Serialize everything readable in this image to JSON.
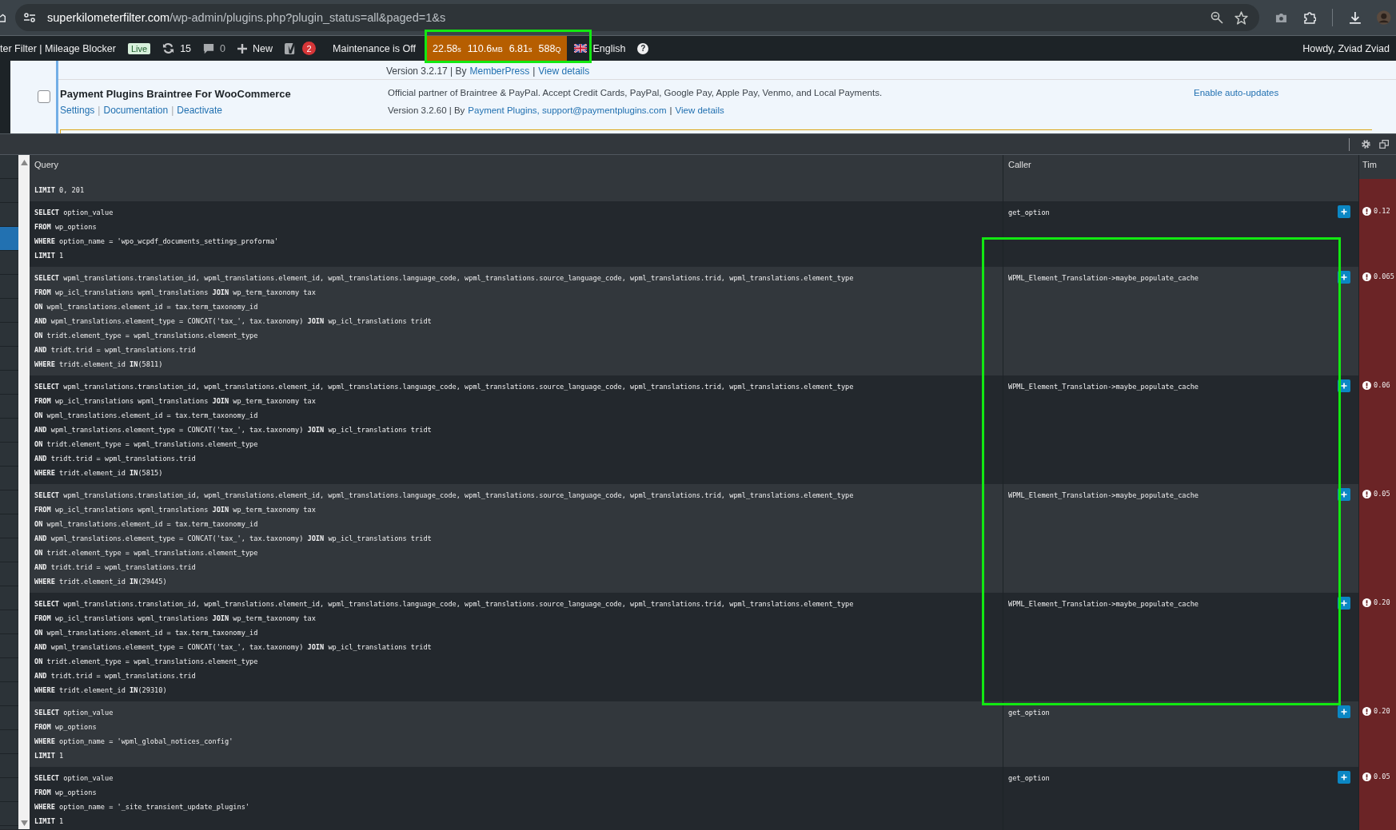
{
  "browser": {
    "url_domain": "superkilometerfilter.com",
    "url_path": "/wp-admin/plugins.php?plugin_status=all&paged=1&s"
  },
  "admin_bar": {
    "site_title": "ter Filter | Mileage Blocker",
    "site_badge": "Live",
    "updates": "15",
    "comments": "0",
    "new": "New",
    "yoast_count": "2",
    "maintenance": "Maintenance is Off",
    "qm_stats": [
      {
        "value": "22.58",
        "unit": "s"
      },
      {
        "value": "110.6",
        "unit": "MB"
      },
      {
        "value": "6.81",
        "unit": "s"
      },
      {
        "value": "588",
        "unit": "Q"
      }
    ],
    "language": "English",
    "help": "?",
    "greeting": "Howdy, Zviad Zviad"
  },
  "plugins": {
    "previous_row": [
      {
        "kind": "text",
        "text": "Version 3.2.17 | By"
      },
      {
        "kind": "link",
        "text": "MemberPress"
      },
      {
        "kind": "text",
        "text": "|"
      },
      {
        "kind": "link",
        "text": "View details"
      }
    ],
    "row": {
      "checked": false,
      "name": "Payment Plugins Braintree For WooCommerce",
      "separator": "|",
      "actions": [
        "Settings",
        "Documentation",
        "Deactivate"
      ],
      "description": "Official partner of Braintree & PayPal. Accept Credit Cards, PayPal, Google Pay, Apple Pay, Venmo, and Local Payments.",
      "meta": [
        {
          "kind": "text",
          "text": "Version 3.2.60 | By"
        },
        {
          "kind": "link",
          "text": "Payment Plugins, support@paymentplugins.com"
        },
        {
          "kind": "text",
          "text": "|"
        },
        {
          "kind": "link",
          "text": "View details"
        }
      ],
      "auto_update": "Enable auto-updates"
    }
  },
  "sidebar_items": [
    {
      "selected": false
    },
    {
      "selected": false
    },
    {
      "selected": false
    },
    {
      "selected": true
    },
    {
      "selected": false
    },
    {
      "selected": false
    },
    {
      "selected": false
    },
    {
      "selected": false
    },
    {
      "selected": false
    },
    {
      "selected": false
    },
    {
      "selected": false
    },
    {
      "selected": false
    },
    {
      "selected": false
    },
    {
      "selected": false
    },
    {
      "selected": false
    },
    {
      "selected": false
    },
    {
      "selected": false
    },
    {
      "selected": false
    },
    {
      "selected": false
    },
    {
      "selected": false
    },
    {
      "selected": false
    },
    {
      "selected": false
    },
    {
      "selected": false
    },
    {
      "selected": false
    },
    {
      "selected": false
    },
    {
      "selected": false
    },
    {
      "selected": false
    },
    {
      "selected": false
    }
  ],
  "query_monitor": {
    "columns": [
      "Query",
      "Caller",
      "Tim"
    ],
    "rows": [
      {
        "lines": [
          "**LIMIT** 0, 201"
        ]
      },
      {
        "lines": [
          "**SELECT** option_value",
          "**FROM** wp_options",
          "**WHERE** option_name = 'wpo_wcpdf_documents_settings_proforma'",
          "**LIMIT** 1"
        ],
        "caller": "get_option",
        "time": "0.12"
      },
      {
        "lines": [
          "**SELECT** wpml_translations.translation_id, wpml_translations.element_id, wpml_translations.language_code, wpml_translations.source_language_code, wpml_translations.trid, wpml_translations.element_type",
          "**FROM** wp_icl_translations wpml_translations **JOIN** wp_term_taxonomy tax",
          "**ON** wpml_translations.element_id = tax.term_taxonomy_id",
          "**AND** wpml_translations.element_type = CONCAT('tax_', tax.taxonomy) **JOIN** wp_icl_translations tridt",
          "**ON** tridt.element_type = wpml_translations.element_type",
          "**AND** tridt.trid = wpml_translations.trid",
          "**WHERE** tridt.element_id **IN**(5811)"
        ],
        "caller": "WPML_Element_Translation->maybe_populate_cache",
        "time": "0.065"
      },
      {
        "lines": [
          "**SELECT** wpml_translations.translation_id, wpml_translations.element_id, wpml_translations.language_code, wpml_translations.source_language_code, wpml_translations.trid, wpml_translations.element_type",
          "**FROM** wp_icl_translations wpml_translations **JOIN** wp_term_taxonomy tax",
          "**ON** wpml_translations.element_id = tax.term_taxonomy_id",
          "**AND** wpml_translations.element_type = CONCAT('tax_', tax.taxonomy) **JOIN** wp_icl_translations tridt",
          "**ON** tridt.element_type = wpml_translations.element_type",
          "**AND** tridt.trid = wpml_translations.trid",
          "**WHERE** tridt.element_id **IN**(5815)"
        ],
        "caller": "WPML_Element_Translation->maybe_populate_cache",
        "time": "0.06"
      },
      {
        "lines": [
          "**SELECT** wpml_translations.translation_id, wpml_translations.element_id, wpml_translations.language_code, wpml_translations.source_language_code, wpml_translations.trid, wpml_translations.element_type",
          "**FROM** wp_icl_translations wpml_translations **JOIN** wp_term_taxonomy tax",
          "**ON** wpml_translations.element_id = tax.term_taxonomy_id",
          "**AND** wpml_translations.element_type = CONCAT('tax_', tax.taxonomy) **JOIN** wp_icl_translations tridt",
          "**ON** tridt.element_type = wpml_translations.element_type",
          "**AND** tridt.trid = wpml_translations.trid",
          "**WHERE** tridt.element_id **IN**(29445)"
        ],
        "caller": "WPML_Element_Translation->maybe_populate_cache",
        "time": "0.05"
      },
      {
        "lines": [
          "**SELECT** wpml_translations.translation_id, wpml_translations.element_id, wpml_translations.language_code, wpml_translations.source_language_code, wpml_translations.trid, wpml_translations.element_type",
          "**FROM** wp_icl_translations wpml_translations **JOIN** wp_term_taxonomy tax",
          "**ON** wpml_translations.element_id = tax.term_taxonomy_id",
          "**AND** wpml_translations.element_type = CONCAT('tax_', tax.taxonomy) **JOIN** wp_icl_translations tridt",
          "**ON** tridt.element_type = wpml_translations.element_type",
          "**AND** tridt.trid = wpml_translations.trid",
          "**WHERE** tridt.element_id **IN**(29310)"
        ],
        "caller": "WPML_Element_Translation->maybe_populate_cache",
        "time": "0.20"
      },
      {
        "lines": [
          "**SELECT** option_value",
          "**FROM** wp_options",
          "**WHERE** option_name = 'wpml_global_notices_config'",
          "**LIMIT** 1"
        ],
        "caller": "get_option",
        "time": "0.20"
      },
      {
        "lines": [
          "**SELECT** option_value",
          "**FROM** wp_options",
          "**WHERE** option_name = '_site_transient_update_plugins'",
          "**LIMIT** 1"
        ],
        "caller": "get_option",
        "time": "0.05"
      }
    ]
  }
}
